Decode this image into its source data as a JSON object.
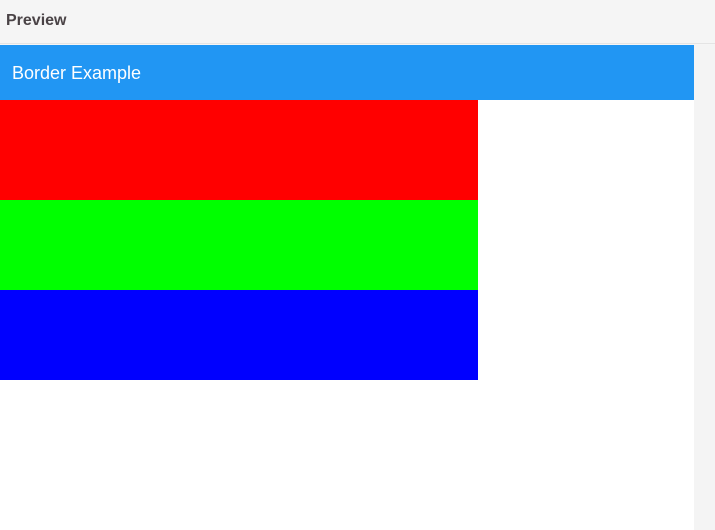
{
  "preview": {
    "title": "Preview"
  },
  "app_bar": {
    "title": "Border Example",
    "color": "#2196F3"
  },
  "boxes": [
    {
      "name": "red-box",
      "color": "#FF0000"
    },
    {
      "name": "green-box",
      "color": "#00FF00"
    },
    {
      "name": "blue-box",
      "color": "#0000FF"
    }
  ]
}
